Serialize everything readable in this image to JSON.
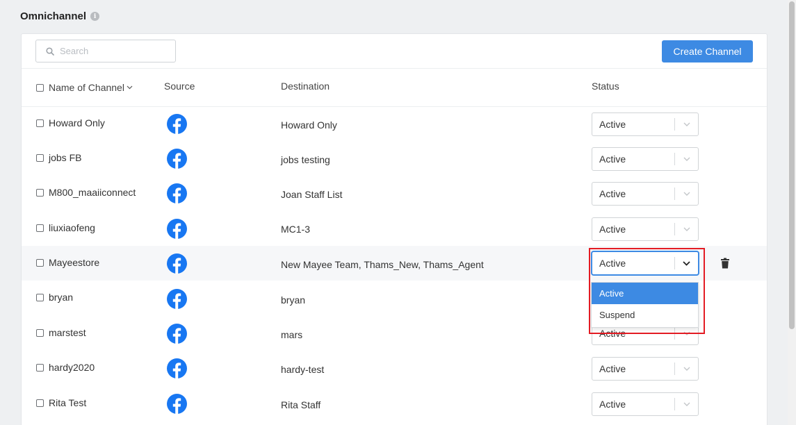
{
  "page": {
    "title": "Omnichannel"
  },
  "toolbar": {
    "search_placeholder": "Search",
    "create_label": "Create Channel"
  },
  "table": {
    "headers": {
      "name": "Name of Channel",
      "source": "Source",
      "destination": "Destination",
      "status": "Status"
    },
    "rows": [
      {
        "name": "Howard Only",
        "source": "facebook",
        "destination": "Howard Only",
        "status": "Active"
      },
      {
        "name": "jobs FB",
        "source": "facebook",
        "destination": "jobs testing",
        "status": "Active"
      },
      {
        "name": "M800_maaiiconnect",
        "source": "facebook",
        "destination": "Joan Staff List",
        "status": "Active"
      },
      {
        "name": "liuxiaofeng",
        "source": "facebook",
        "destination": "MC1-3",
        "status": "Active"
      },
      {
        "name": "Mayeestore",
        "source": "facebook",
        "destination": "New Mayee Team, Thams_New, Thams_Agent",
        "status": "Active"
      },
      {
        "name": "bryan",
        "source": "facebook",
        "destination": "bryan",
        "status": "Active"
      },
      {
        "name": "marstest",
        "source": "facebook",
        "destination": "mars",
        "status": "Active"
      },
      {
        "name": "hardy2020",
        "source": "facebook",
        "destination": "hardy-test",
        "status": "Active"
      },
      {
        "name": "Rita Test",
        "source": "facebook",
        "destination": "Rita Staff",
        "status": "Active"
      }
    ]
  },
  "dropdown": {
    "options": [
      "Active",
      "Suspend"
    ],
    "selected": "Active"
  },
  "colors": {
    "accent": "#3d8ae3",
    "facebook": "#1877f2",
    "highlight": "#e31b23"
  }
}
